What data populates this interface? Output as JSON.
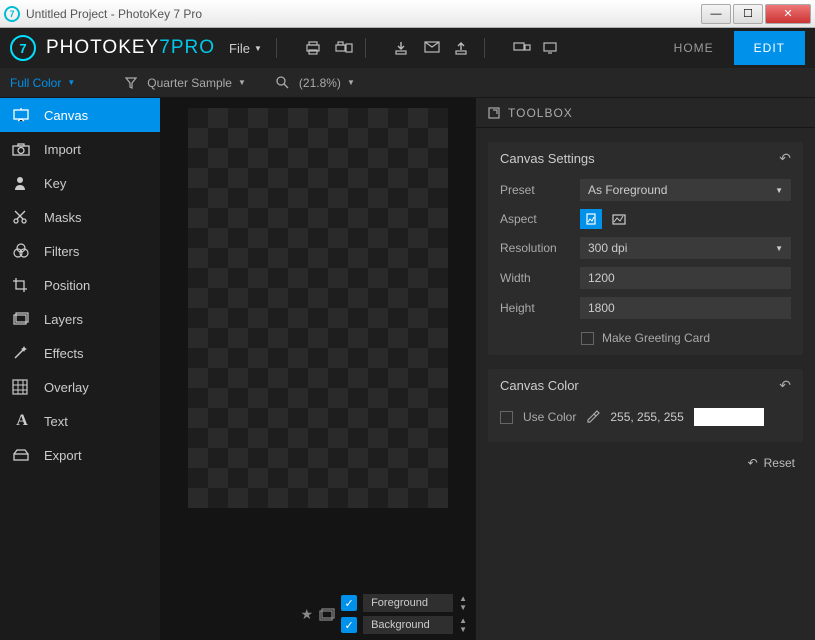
{
  "window": {
    "title": "Untitled Project - PhotoKey 7 Pro"
  },
  "brand": {
    "name1": "PHOTOKEY",
    "seven": "7",
    "pro": "PRO",
    "file_menu": "File"
  },
  "nav": {
    "home": "HOME",
    "edit": "EDIT"
  },
  "optbar": {
    "color_mode": "Full Color",
    "sample": "Quarter Sample",
    "zoom": "(21.8%)"
  },
  "sidebar": {
    "items": [
      {
        "label": "Canvas"
      },
      {
        "label": "Import"
      },
      {
        "label": "Key"
      },
      {
        "label": "Masks"
      },
      {
        "label": "Filters"
      },
      {
        "label": "Position"
      },
      {
        "label": "Layers"
      },
      {
        "label": "Effects"
      },
      {
        "label": "Overlay"
      },
      {
        "label": "Text"
      },
      {
        "label": "Export"
      }
    ]
  },
  "layers": {
    "fg": "Foreground",
    "bg": "Background"
  },
  "toolbox": {
    "header": "TOOLBOX",
    "settings_title": "Canvas Settings",
    "preset_label": "Preset",
    "preset_value": "As Foreground",
    "aspect_label": "Aspect",
    "resolution_label": "Resolution",
    "resolution_value": "300 dpi",
    "width_label": "Width",
    "width_value": "1200",
    "height_label": "Height",
    "height_value": "1800",
    "greeting": "Make Greeting Card",
    "color_title": "Canvas Color",
    "use_color": "Use Color",
    "color_value": "255, 255, 255",
    "reset": "Reset"
  }
}
